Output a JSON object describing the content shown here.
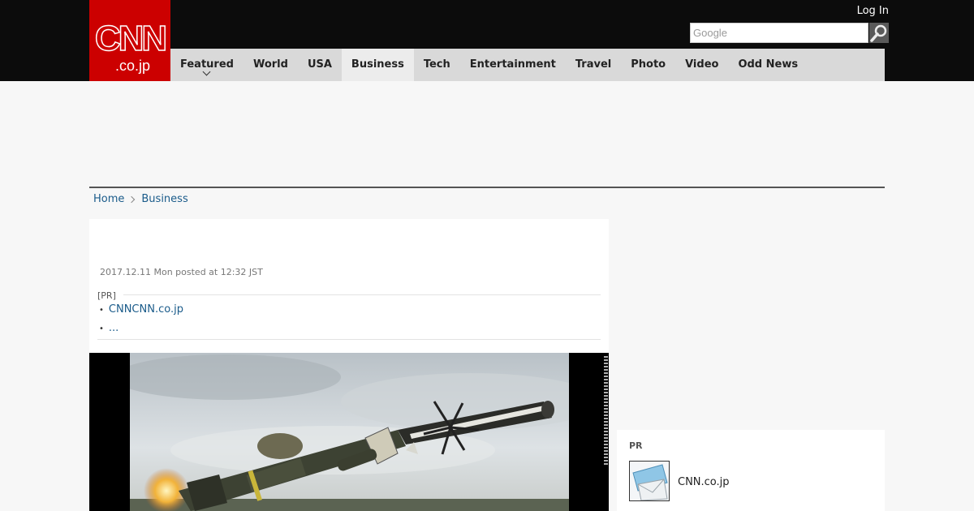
{
  "header": {
    "logo_text": "CNN",
    "logo_sub": ".co.jp",
    "login": "Log In",
    "search_placeholder": "Google"
  },
  "nav": [
    {
      "label": "Featured",
      "dropdown": true
    },
    {
      "label": "World"
    },
    {
      "label": "USA"
    },
    {
      "label": "Business",
      "active": true
    },
    {
      "label": "Tech"
    },
    {
      "label": "Entertainment"
    },
    {
      "label": "Travel"
    },
    {
      "label": "Photo"
    },
    {
      "label": "Video"
    },
    {
      "label": "Odd News"
    }
  ],
  "breadcrumb": {
    "home": "Home",
    "current": "Business"
  },
  "article": {
    "date": "2017.12.11 Mon posted at 12:32 JST",
    "pr_label": "[PR]",
    "pr_links": [
      "CNNCNN.co.jp",
      "..."
    ]
  },
  "sidebar_pr": {
    "title": "PR",
    "item_name": "CNN.co.jp"
  },
  "colors": {
    "brand_red": "#cc0000",
    "link_blue": "#1a5b8a",
    "nav_bg": "#d9d9d9"
  }
}
